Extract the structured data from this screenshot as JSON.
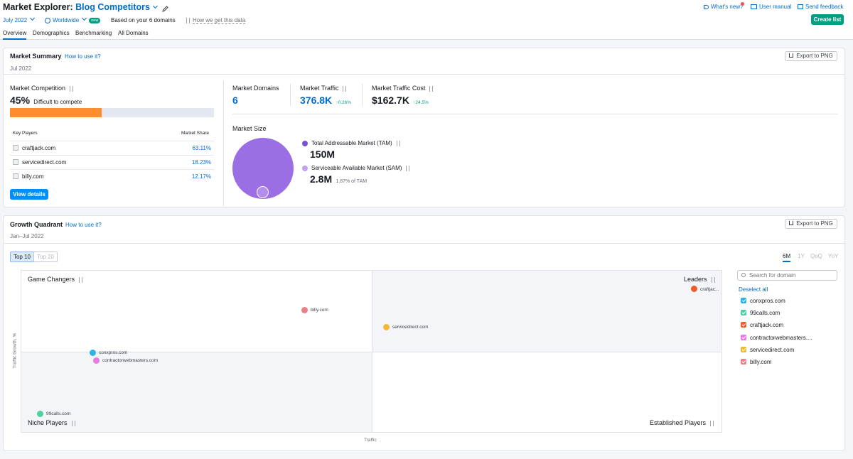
{
  "header": {
    "title_prefix": "Market Explorer:",
    "title_name": "Blog Competitors",
    "date": "July 2022",
    "region": "Worldwide",
    "new_badge": "new",
    "based_on": "Based on your 6 domains",
    "how_link": "How we get this data",
    "whats_new": "What's new?",
    "user_manual": "User manual",
    "feedback": "Send feedback",
    "create_list": "Create list",
    "tabs": [
      "Overview",
      "Demographics",
      "Benchmarking",
      "All Domains"
    ]
  },
  "summary": {
    "title": "Market Summary",
    "how": "How to use it?",
    "date": "Jul 2022",
    "export": "Export to PNG",
    "competition_label": "Market Competition",
    "competition_pct": "45%",
    "competition_text": "Difficult to compete",
    "competition_fill": 0.45,
    "kp_header": "Key Players",
    "ms_header": "Market Share",
    "players": [
      {
        "name": "craftjack.com",
        "share": "63.11%"
      },
      {
        "name": "servicedirect.com",
        "share": "18.23%"
      },
      {
        "name": "billy.com",
        "share": "12.17%"
      }
    ],
    "view_details": "View details",
    "domains_label": "Market Domains",
    "domains_value": "6",
    "traffic_label": "Market Traffic",
    "traffic_value": "376.8K",
    "traffic_change": "0.26%",
    "cost_label": "Market Traffic Cost",
    "cost_value": "$162.7K",
    "cost_change": "24.5%",
    "size_label": "Market Size",
    "tam_label": "Total Addressable Market (TAM)",
    "tam_value": "150M",
    "sam_label": "Serviceable Available Market (SAM)",
    "sam_value": "2.8M",
    "sam_note": "1.87% of TAM",
    "colors": {
      "tam": "#9b6ee4",
      "sam": "#c3a0f0",
      "bar": "#ff8c2e"
    }
  },
  "growth": {
    "title": "Growth Quadrant",
    "how": "How to use it?",
    "date": "Jan–Jul 2022",
    "export": "Export to PNG",
    "top10": "Top 10",
    "top20": "Top 20",
    "periods": [
      "6M",
      "1Y",
      "QoQ",
      "YoY"
    ],
    "q_game": "Game Changers",
    "q_leaders": "Leaders",
    "q_niche": "Niche Players",
    "q_established": "Established Players",
    "y_label": "Traffic Growth, %",
    "x_label": "Traffic",
    "search_placeholder": "Search for domain",
    "deselect": "Deselect all",
    "domains": [
      {
        "name": "conxpros.com",
        "color": "#2bb3e8"
      },
      {
        "name": "99calls.com",
        "color": "#4fd0a0"
      },
      {
        "name": "craftjack.com",
        "color": "#ef5b2a"
      },
      {
        "name": "contractorwebmasters....",
        "color": "#e87ae3"
      },
      {
        "name": "servicedirect.com",
        "color": "#f3b935"
      },
      {
        "name": "billy.com",
        "color": "#ef7f86"
      }
    ],
    "points": {
      "billy": "billy.com",
      "servicedirect": "servicedirect.com",
      "conxpros": "conxpros.com",
      "contractor": "contractorwebmasters.com",
      "calls": "99calls.com",
      "craftjack": "craftjac..."
    }
  }
}
